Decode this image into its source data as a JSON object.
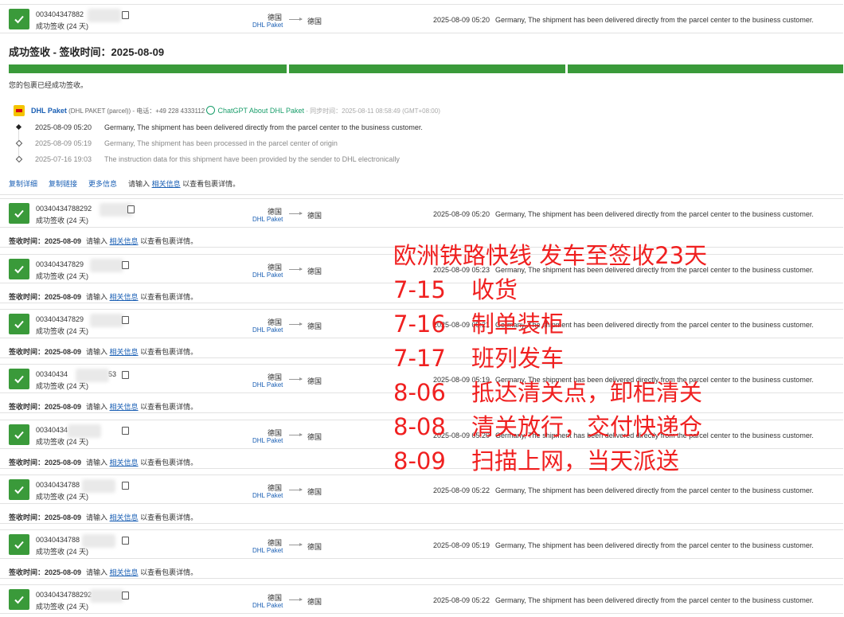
{
  "rows": [
    {
      "tracking": "003404347882",
      "status": "成功签收 (24 天)",
      "origin": "德国",
      "carrier": "DHL Paket",
      "destination": "德国",
      "event_time": "2025-08-09 05:20",
      "event_desc": "Germany, The shipment has been delivered directly from the parcel center to the business customer."
    },
    {
      "tracking": "00340434788292",
      "status": "成功签收 (24 天)",
      "origin": "德国",
      "carrier": "DHL Paket",
      "destination": "德国",
      "event_time": "2025-08-09 05:20",
      "event_desc": "Germany, The shipment has been delivered directly from the parcel center to the business customer."
    },
    {
      "tracking": "003404347829",
      "status": "成功签收 (24 天)",
      "origin": "德国",
      "carrier": "DHL Paket",
      "destination": "德国",
      "event_time": "2025-08-09 05:23",
      "event_desc": "Germany, The shipment has been delivered directly from the parcel center to the business customer."
    },
    {
      "tracking": "003404347829",
      "status": "成功签收 (24 天)",
      "origin": "德国",
      "carrier": "DHL Paket",
      "destination": "德国",
      "event_time": "2025-08-09 05:21",
      "event_desc": "Germany, The shipment has been delivered directly from the parcel center to the business customer."
    },
    {
      "tracking": "00340434",
      "tracking_tail": "53",
      "status": "成功签收 (24 天)",
      "origin": "德国",
      "carrier": "DHL Paket",
      "destination": "德国",
      "event_time": "2025-08-09 05:19",
      "event_desc": "Germany, The shipment has been delivered directly from the parcel center to the business customer."
    },
    {
      "tracking": "00340434",
      "status": "成功签收 (24 天)",
      "origin": "德国",
      "carrier": "DHL Paket",
      "destination": "德国",
      "event_time": "2025-08-09 05:20",
      "event_desc": "Germany, The shipment has been delivered directly from the parcel center to the business customer."
    },
    {
      "tracking": "00340434788",
      "status": "成功签收 (24 天)",
      "origin": "德国",
      "carrier": "DHL Paket",
      "destination": "德国",
      "event_time": "2025-08-09 05:22",
      "event_desc": "Germany, The shipment has been delivered directly from the parcel center to the business customer."
    },
    {
      "tracking": "00340434788",
      "status": "成功签收 (24 天)",
      "origin": "德国",
      "carrier": "DHL Paket",
      "destination": "德国",
      "event_time": "2025-08-09 05:19",
      "event_desc": "Germany, The shipment has been delivered directly from the parcel center to the business customer."
    },
    {
      "tracking": "00340434788292",
      "status": "成功签收 (24 天)",
      "origin": "德国",
      "carrier": "DHL Paket",
      "destination": "德国",
      "event_time": "2025-08-09 05:22",
      "event_desc": "Germany, The shipment has been delivered directly from the parcel center to the business customer."
    }
  ],
  "signed_bar": {
    "label": "签收时间：2025-08-09",
    "hint_prefix": "请输入",
    "hint_link": "相关信息",
    "hint_suffix": "以查看包裹详情。"
  },
  "detail": {
    "title": "成功签收 - 签收时间：2025-08-09",
    "note": "您的包裹已经成功签收。",
    "carrier_name": "DHL Paket",
    "carrier_code": "(DHL PAKET (parcel))",
    "phone": "- 电话：+49 228 4333112",
    "chatgpt": "ChatGPT About DHL Paket",
    "sync_time": "- 同步时间：2025-08-11 08:58:49 (GMT+08:00)",
    "events": [
      {
        "time": "2025-08-09 05:20",
        "desc": "Germany, The shipment has been delivered directly from the parcel center to the business customer."
      },
      {
        "time": "2025-08-09 05:19",
        "desc": "Germany, The shipment has been processed in the parcel center of origin"
      },
      {
        "time": "2025-07-16 19:03",
        "desc": "The instruction data for this shipment have been provided by the sender to DHL electronically"
      }
    ],
    "actions": [
      "复制详细",
      "复制链接",
      "更多信息"
    ],
    "hint_prefix": "请输入",
    "hint_link": "相关信息",
    "hint_suffix": "以查看包裹详情。",
    "progress_segments": 3
  },
  "overlay": {
    "heading": "欧洲铁路快线 发车至签收23天",
    "lines": [
      {
        "date": "7-15",
        "text": "收货"
      },
      {
        "date": "7-16",
        "text": "制单装柜"
      },
      {
        "date": "7-17",
        "text": "班列发车"
      },
      {
        "date": "8-06",
        "text": "抵达清关点，卸柜清关"
      },
      {
        "date": "8-08",
        "text": "清关放行，交付快递仓"
      },
      {
        "date": "8-09",
        "text": "扫描上网，当天派送"
      }
    ]
  },
  "colors": {
    "success": "#3a9a3a",
    "link": "#1a5fb4",
    "overlay": "#f02020"
  }
}
